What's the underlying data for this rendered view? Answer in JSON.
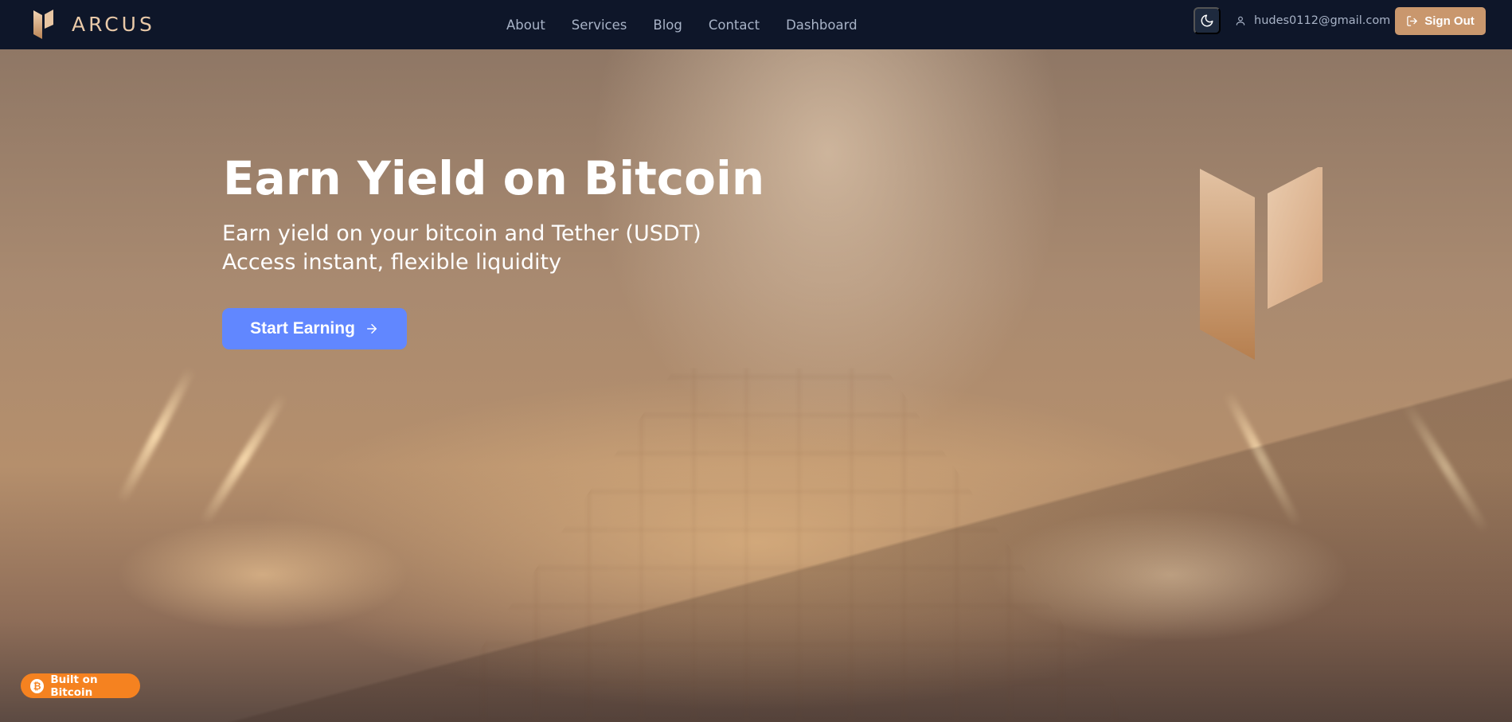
{
  "brand": {
    "name": "ARCUS",
    "logo_icon": "arcus-logo-icon"
  },
  "nav": {
    "items": [
      {
        "label": "About"
      },
      {
        "label": "Services"
      },
      {
        "label": "Blog"
      },
      {
        "label": "Contact"
      },
      {
        "label": "Dashboard"
      }
    ]
  },
  "header": {
    "theme_toggle_icon": "moon-icon",
    "user_email": "hudes0112@gmail.com",
    "user_icon": "user-icon",
    "sign_out_label": "Sign Out",
    "sign_out_icon": "sign-out-icon"
  },
  "hero": {
    "title": "Earn Yield on Bitcoin",
    "subtitle_line1": "Earn yield on your bitcoin and Tether (USDT)",
    "subtitle_line2": "Access instant, flexible liquidity",
    "cta_label": "Start Earning",
    "cta_icon": "arrow-right-icon",
    "decor_icon": "arcus-mark-icon"
  },
  "badge": {
    "label": "Built on Bitcoin",
    "icon": "bitcoin-icon",
    "coin_glyph": "₿"
  },
  "colors": {
    "header_bg": "#0e1629",
    "accent_gold": "#c9976d",
    "cta_blue": "#6187ff",
    "badge_orange": "#f58220"
  }
}
